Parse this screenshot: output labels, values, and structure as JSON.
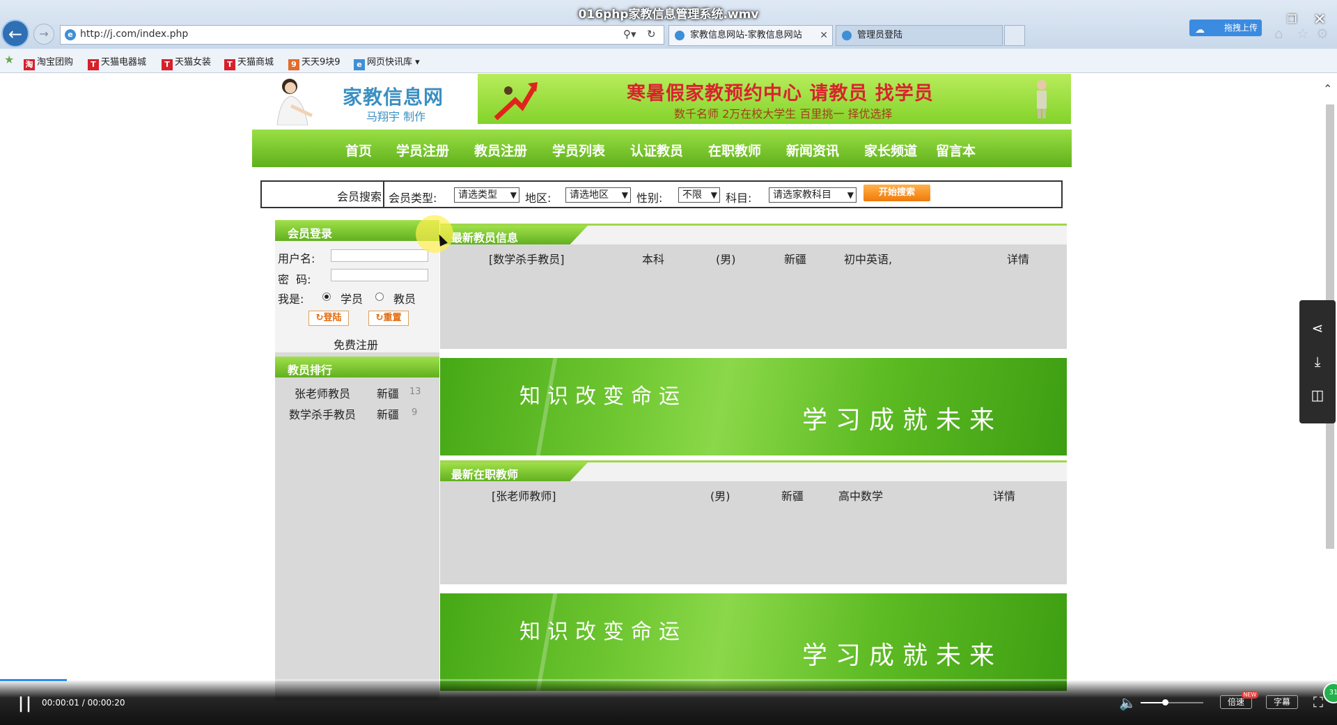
{
  "video": {
    "title": "016php家教信息管理系统.wmv",
    "time": "00:00:01 / 00:00:20",
    "progress_fraction": 0.05,
    "speed_label": "倍速",
    "new_badge": "NEW",
    "subtitle_label": "字幕",
    "upload_label": "拖拽上传",
    "green_ball_label": "31"
  },
  "browser": {
    "url": "http://j.com/index.php",
    "tabs": [
      {
        "label": "家教信息网站-家教信息网站"
      },
      {
        "label": "管理员登陆"
      }
    ],
    "bookmarks": [
      {
        "icon": "淘",
        "label": "淘宝团购"
      },
      {
        "icon": "T",
        "label": "天猫电器城"
      },
      {
        "icon": "T",
        "label": "天猫女装"
      },
      {
        "icon": "T",
        "label": "天猫商城"
      },
      {
        "icon": "9",
        "label": "天天9块9"
      },
      {
        "icon": "e",
        "label": "网页快讯库"
      }
    ]
  },
  "site": {
    "logo_title": "家教信息网",
    "logo_sub": "马翔宇 制作",
    "banner_title": "寒暑假家教预约中心 请教员 找学员",
    "banner_sub": "数千名师 2万在校大学生 百里挑一 择优选择",
    "nav": [
      "首页",
      "学员注册",
      "教员注册",
      "学员列表",
      "认证教员",
      "在职教师",
      "新闻资讯",
      "家长频道",
      "留言本"
    ]
  },
  "search": {
    "label": "会员搜索",
    "type_label": "会员类型:",
    "type_value": "请选类型",
    "area_label": "地区:",
    "area_value": "请选地区",
    "gender_label": "性别:",
    "gender_value": "不限",
    "subject_label": "科目:",
    "subject_value": "请选家教科目",
    "button": "开始搜索"
  },
  "login": {
    "header": "会员登录",
    "username_label": "用户名:",
    "password_label": "密  码:",
    "role_label": "我是:",
    "role_student": "学员",
    "role_teacher": "教员",
    "login_btn": "登陆",
    "reset_btn": "重置",
    "register_link": "免费注册"
  },
  "ranking": {
    "header": "教员排行",
    "items": [
      {
        "name": "张老师教员",
        "area": "新疆",
        "count": "13"
      },
      {
        "name": "数学杀手教员",
        "area": "新疆",
        "count": "9"
      }
    ]
  },
  "latest_teachers": {
    "header": "最新教员信息",
    "row": {
      "name": "[数学杀手教员]",
      "edu": "本科",
      "gender": "(男)",
      "area": "新疆",
      "subject": "初中英语,",
      "detail": "详情"
    }
  },
  "promo": {
    "text1": "知识改变命运",
    "text2": "学习成就未来"
  },
  "latest_onjob": {
    "header": "最新在职教师",
    "row": {
      "name": "[张老师教师]",
      "gender": "(男)",
      "area": "新疆",
      "subject": "高中数学",
      "detail": "详情"
    }
  }
}
